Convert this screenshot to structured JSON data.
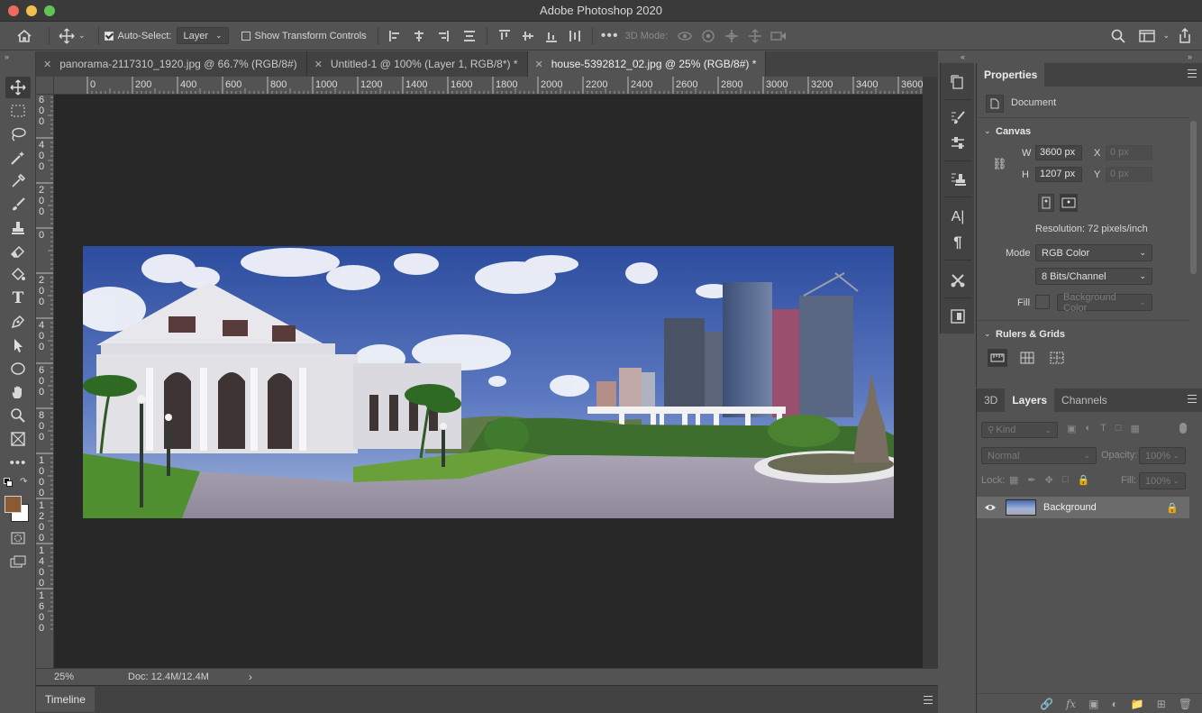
{
  "window": {
    "title": "Adobe Photoshop 2020"
  },
  "options_bar": {
    "auto_select_label": "Auto-Select:",
    "auto_select_value": "Layer",
    "show_transform_label": "Show Transform Controls",
    "three_d_mode_label": "3D Mode:"
  },
  "tabs": [
    {
      "label": "panorama-2117310_1920.jpg @ 66.7% (RGB/8#)"
    },
    {
      "label": "Untitled-1 @ 100% (Layer 1, RGB/8*) *"
    },
    {
      "label": "house-5392812_02.jpg @ 25% (RGB/8#) *"
    }
  ],
  "ruler_h_ticks": [
    "0",
    "200",
    "400",
    "600",
    "800",
    "1000",
    "1200",
    "1400",
    "1600",
    "1800",
    "2000",
    "2200",
    "2400",
    "2600",
    "2800",
    "3000",
    "3200",
    "3400",
    "3600"
  ],
  "ruler_v_ticks": [
    "6\n0\n0",
    "4\n0\n0",
    "2\n0\n0",
    "0",
    "2\n0\n0",
    "4\n0\n0",
    "6\n0\n0",
    "8\n0\n0",
    "1\n0\n0\n0",
    "1\n2\n0\n0",
    "1\n4\n0\n0",
    "1\n6\n0\n0"
  ],
  "status_bar": {
    "zoom": "25%",
    "doc_info": "Doc: 12.4M/12.4M"
  },
  "timeline": {
    "label": "Timeline"
  },
  "properties": {
    "tab_label": "Properties",
    "doc_label": "Document",
    "canvas_label": "Canvas",
    "w_label": "W",
    "w_value": "3600 px",
    "h_label": "H",
    "h_value": "1207 px",
    "x_label": "X",
    "x_placeholder": "0 px",
    "y_label": "Y",
    "y_placeholder": "0 px",
    "resolution": "Resolution: 72 pixels/inch",
    "mode_label": "Mode",
    "mode_value": "RGB Color",
    "bits_value": "8 Bits/Channel",
    "fill_label": "Fill",
    "fill_value": "Background Color",
    "rulers_grids_label": "Rulers & Grids"
  },
  "layers_panel": {
    "tabs": [
      {
        "label": "3D"
      },
      {
        "label": "Layers"
      },
      {
        "label": "Channels"
      }
    ],
    "kind_placeholder": "Kind",
    "blend_mode": "Normal",
    "opacity_label": "Opacity:",
    "opacity_value": "100%",
    "lock_label": "Lock:",
    "fill_label": "Fill:",
    "fill_value": "100%",
    "layers": [
      {
        "name": "Background",
        "visible": true,
        "locked": true
      }
    ],
    "footer_fx": "fx"
  },
  "colors": {
    "foreground": "#8a5a34",
    "background": "#ffffff",
    "sky_top": "#2c4c9e",
    "sky_bottom": "#9fb3d9",
    "ground": "#9a92a6"
  }
}
